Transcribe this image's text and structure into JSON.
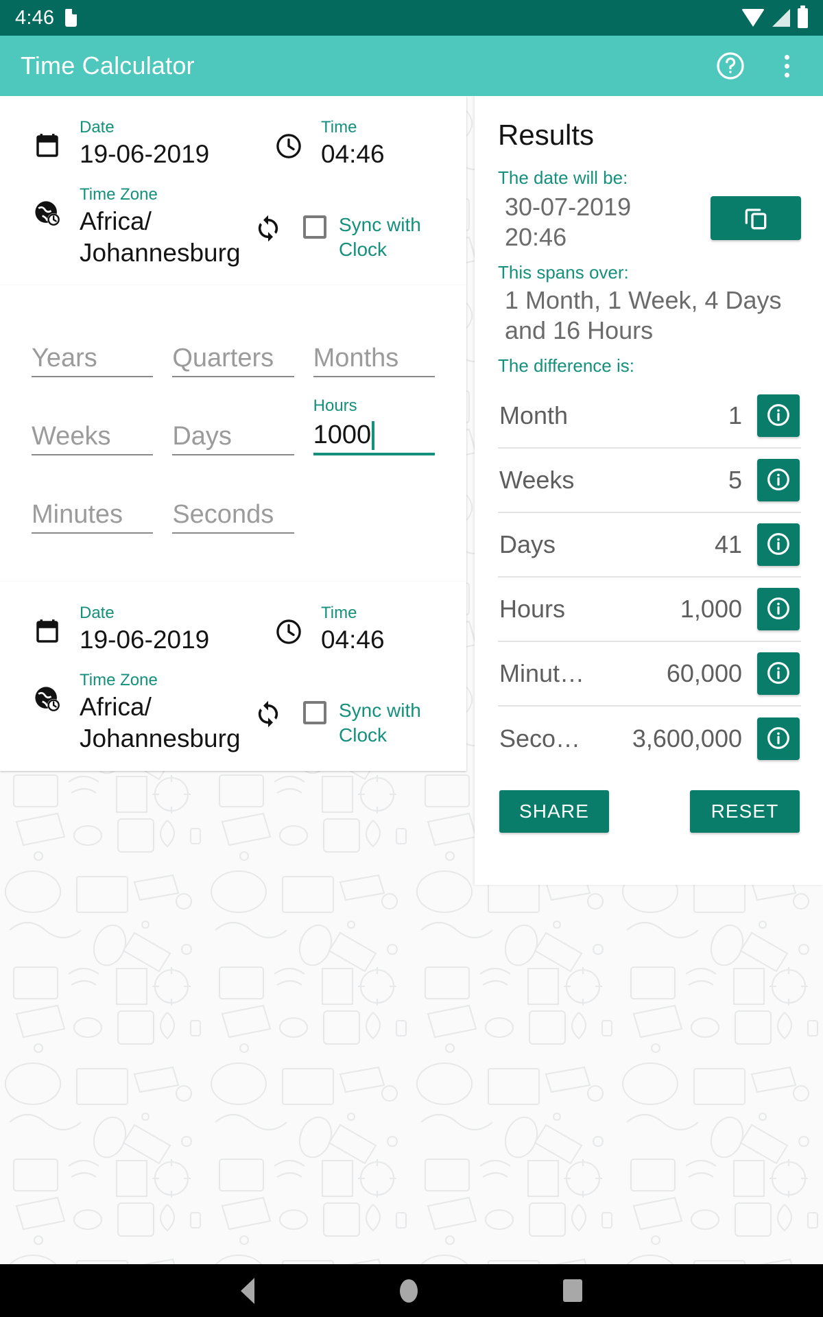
{
  "status_bar": {
    "clock": "4:46",
    "icons": [
      "sd-card-icon",
      "wifi-icon",
      "cellular-signal-icon",
      "battery-icon"
    ]
  },
  "app_bar": {
    "title": "Time Calculator",
    "help_icon": "help-circle-icon",
    "overflow_icon": "more-vert-icon"
  },
  "start_card": {
    "date_label": "Date",
    "date_value": "19-06-2019",
    "time_label": "Time",
    "time_value": "04:46",
    "timezone_label": "Time Zone",
    "timezone_value": "Africa/\nJohannesburg",
    "swap_icon": "swap-timezone-icon",
    "sync_label": "Sync with Clock",
    "sync_checked": false,
    "calendar_icon": "calendar-icon",
    "clock_icon": "clock-icon",
    "globe_icon": "globe-clock-icon"
  },
  "duration_inputs": {
    "fields": [
      {
        "name": "years",
        "placeholder": "Years",
        "value": "",
        "label": "",
        "focused": false
      },
      {
        "name": "quarters",
        "placeholder": "Quarters",
        "value": "",
        "label": "",
        "focused": false
      },
      {
        "name": "months",
        "placeholder": "Months",
        "value": "",
        "label": "",
        "focused": false
      },
      {
        "name": "weeks",
        "placeholder": "Weeks",
        "value": "",
        "label": "",
        "focused": false
      },
      {
        "name": "days",
        "placeholder": "Days",
        "value": "",
        "label": "",
        "focused": false
      },
      {
        "name": "hours",
        "placeholder": "Hours",
        "value": "1000",
        "label": "Hours",
        "focused": true
      },
      {
        "name": "minutes",
        "placeholder": "Minutes",
        "value": "",
        "label": "",
        "focused": false
      },
      {
        "name": "seconds",
        "placeholder": "Seconds",
        "value": "",
        "label": "",
        "focused": false
      }
    ]
  },
  "end_card": {
    "date_label": "Date",
    "date_value": "19-06-2019",
    "time_label": "Time",
    "time_value": "04:46",
    "timezone_label": "Time Zone",
    "timezone_value": "Africa/\nJohannesburg",
    "sync_label": "Sync with Clock",
    "sync_checked": false
  },
  "results": {
    "title": "Results",
    "date_will_be_label": "The date will be:",
    "date_will_be_value": "30-07-2019\n20:46",
    "copy_icon": "copy-icon",
    "spans_over_label": "This spans over:",
    "spans_over_value": "1 Month, 1 Week, 4 Days and 16 Hours",
    "difference_label": "The difference is:",
    "difference_rows": [
      {
        "name": "Month",
        "value": "1",
        "info_icon": "info-icon"
      },
      {
        "name": "Weeks",
        "value": "5",
        "info_icon": "info-icon"
      },
      {
        "name": "Days",
        "value": "41",
        "info_icon": "info-icon"
      },
      {
        "name": "Hours",
        "value": "1,000",
        "info_icon": "info-icon"
      },
      {
        "name": "Minut…",
        "value": "60,000",
        "info_icon": "info-icon"
      },
      {
        "name": "Seco…",
        "value": "3,600,000",
        "info_icon": "info-icon"
      }
    ],
    "share_label": "SHARE",
    "reset_label": "RESET"
  },
  "nav_bar": {
    "back": "back-nav-button",
    "home": "home-nav-button",
    "recents": "recents-nav-button"
  },
  "colors": {
    "status_bar": "#046a5e",
    "app_bar": "#4ec8bc",
    "accent": "#14907c",
    "button": "#0a7d6a",
    "card": "#ffffff",
    "page_bg": "#fafafa"
  }
}
